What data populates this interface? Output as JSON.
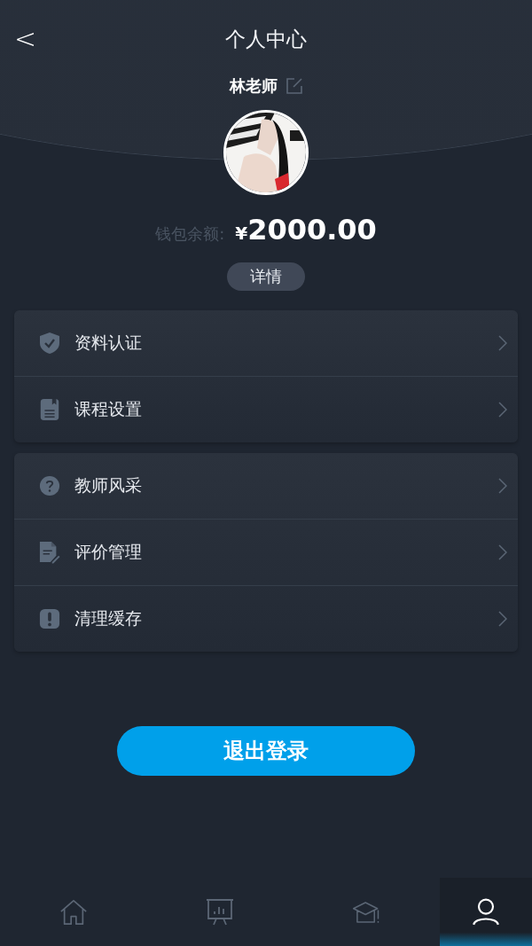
{
  "header": {
    "title": "个人中心",
    "back_icon": "<"
  },
  "profile": {
    "name": "林老师",
    "balance_label": "钱包余额:",
    "currency": "¥",
    "balance": "2000.00",
    "details_button": "详情"
  },
  "menu_groups": [
    {
      "items": [
        {
          "kind": "shield",
          "label": "资料认证"
        },
        {
          "kind": "document",
          "label": "课程设置"
        }
      ]
    },
    {
      "items": [
        {
          "kind": "question",
          "label": "教师风采"
        },
        {
          "kind": "edit",
          "label": "评价管理"
        },
        {
          "kind": "alert",
          "label": "清理缓存"
        }
      ]
    }
  ],
  "logout_button": "退出登录",
  "tab_bar": [
    {
      "kind": "home",
      "selected": false
    },
    {
      "kind": "chart",
      "selected": false
    },
    {
      "kind": "cap",
      "selected": false
    },
    {
      "kind": "user",
      "selected": true
    }
  ]
}
